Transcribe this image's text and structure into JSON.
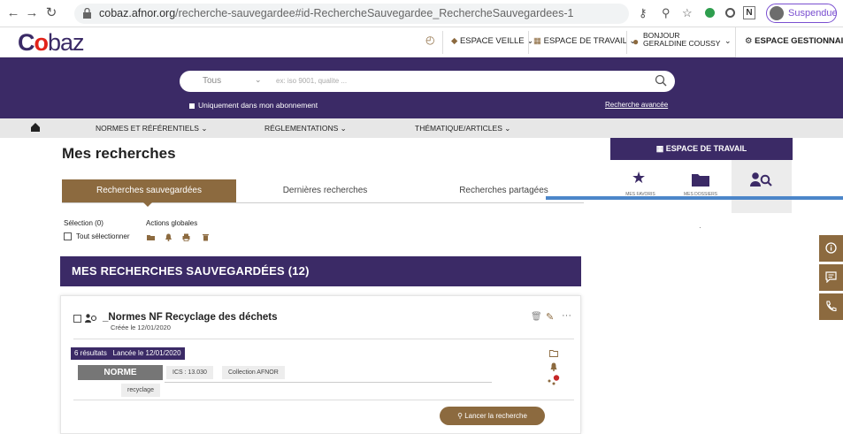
{
  "browser": {
    "url_domain": "cobaz.afnor.org",
    "url_path": "/recherche-sauvegardee#id-RechercheSauvegardee_RechercheSauvegardees-1",
    "profile_label": "Suspendue"
  },
  "header": {
    "logo_c": "C",
    "logo_o": "o",
    "logo_baz": "baz",
    "veille": "ESPACE VEILLE",
    "travail": "ESPACE DE TRAVAIL",
    "bonjour": "BONJOUR",
    "user": "GERALDINE COUSSY",
    "gestionnaire": "ESPACE GESTIONNAIRE"
  },
  "search": {
    "scope": "Tous",
    "placeholder": "ex: iso 9001, qualite ...",
    "only_subscription": "Uniquement dans mon abonnement",
    "advanced": "Recherche avancée"
  },
  "nav": {
    "items": [
      "NORMES ET RÉFÉRENTIELS",
      "RÉGLEMENTATIONS",
      "THÉMATIQUE/ARTICLES"
    ]
  },
  "main": {
    "title": "Mes recherches",
    "tabs": [
      "Recherches sauvegardées",
      "Dernières recherches",
      "Recherches partagées"
    ],
    "selection": "Sélection (0)",
    "global_actions": "Actions globales",
    "select_all": "Tout sélectionner",
    "section_title": "MES RECHERCHES SAUVEGARDÉES (12)"
  },
  "card": {
    "title": "_Normes NF Recyclage des déchets",
    "created": "Créée le 12/01/2020",
    "results": "6 résultats",
    "launched": "Lancée le 12/01/2020",
    "type": "NORME",
    "ics": "ICS : 13.030",
    "collection": "Collection AFNOR",
    "keyword": "recyclage",
    "run_label": "Lancer la recherche",
    "more": "···"
  },
  "workspace": {
    "title": "ESPACE DE TRAVAIL",
    "cells": [
      "MES FAVORIS",
      "MES DOSSIERS"
    ]
  },
  "colors": {
    "brand_purple": "#3b2a66",
    "brand_brown": "#8c6a3f",
    "logo_red": "#e2231a"
  }
}
